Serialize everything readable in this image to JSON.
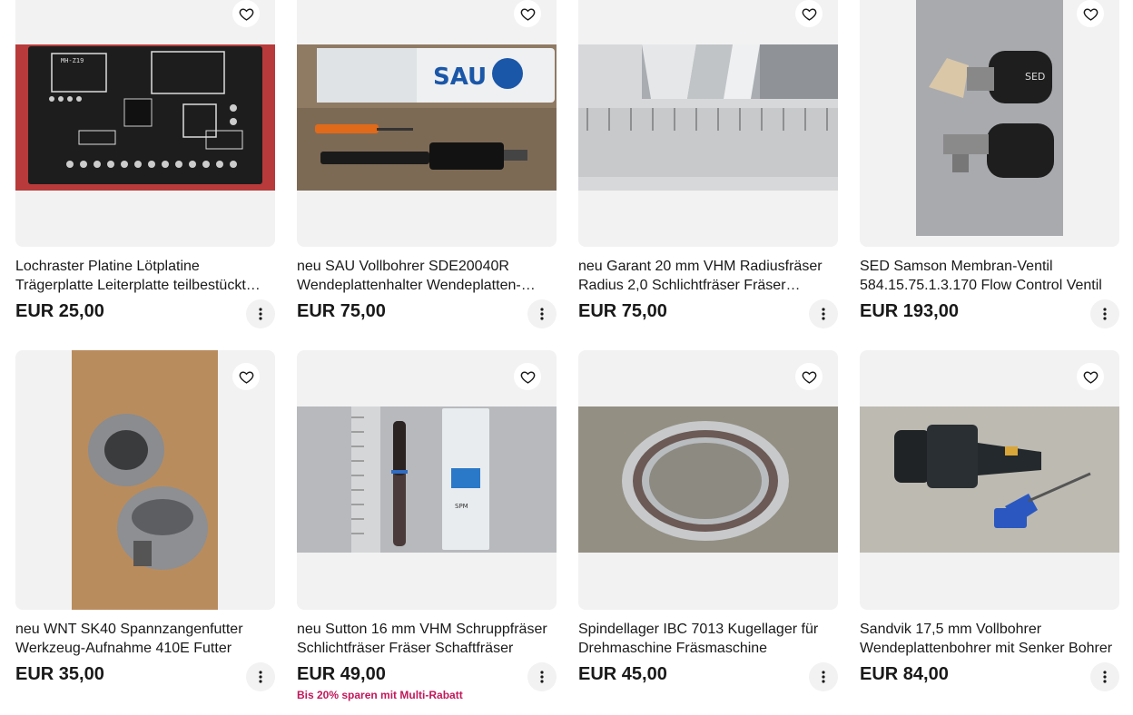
{
  "listings": [
    {
      "title": "Lochraster Platine Lötplatine Trägerplatte Leiterplatte teilbestückt Sensor",
      "price": "EUR 25,00"
    },
    {
      "title": "neu SAU Vollbohrer SDE20040R Wendeplattenhalter Wendeplatten-Bohrer",
      "price": "EUR 75,00"
    },
    {
      "title": "neu Garant 20 mm VHM Radiusfräser Radius 2,0 Schlichtfräser Fräser Schaftfräser",
      "price": "EUR 75,00"
    },
    {
      "title": "SED Samson Membran-Ventil 584.15.75.1.3.170 Flow Control Ventil",
      "price": "EUR 193,00"
    },
    {
      "title": "neu WNT SK40 Spannzangenfutter Werkzeug-Aufnahme 410E Futter",
      "price": "EUR 35,00"
    },
    {
      "title": "neu Sutton 16 mm VHM Schruppfräser Schlichtfräser Fräser Schaftfräser",
      "price": "EUR 49,00",
      "promo": "Bis 20% sparen mit Multi-Rabatt"
    },
    {
      "title": "Spindellager IBC 7013 Kugellager für Drehmaschine Fräsmaschine",
      "price": "EUR 45,00"
    },
    {
      "title": "Sandvik 17,5 mm Vollbohrer Wendeplattenbohrer mit Senker Bohrer",
      "price": "EUR 84,00"
    }
  ],
  "icons": {
    "watch": "heart-icon",
    "more": "more-vertical-icon"
  },
  "colors": {
    "image_background": "#f2f2f2",
    "promo": "#c2185b",
    "text": "#191919"
  },
  "photo_labels": {
    "pcb_label_1": "MH-Z19",
    "box_brand": "SAU",
    "valve_label": "SED",
    "box_code": "SPM"
  }
}
